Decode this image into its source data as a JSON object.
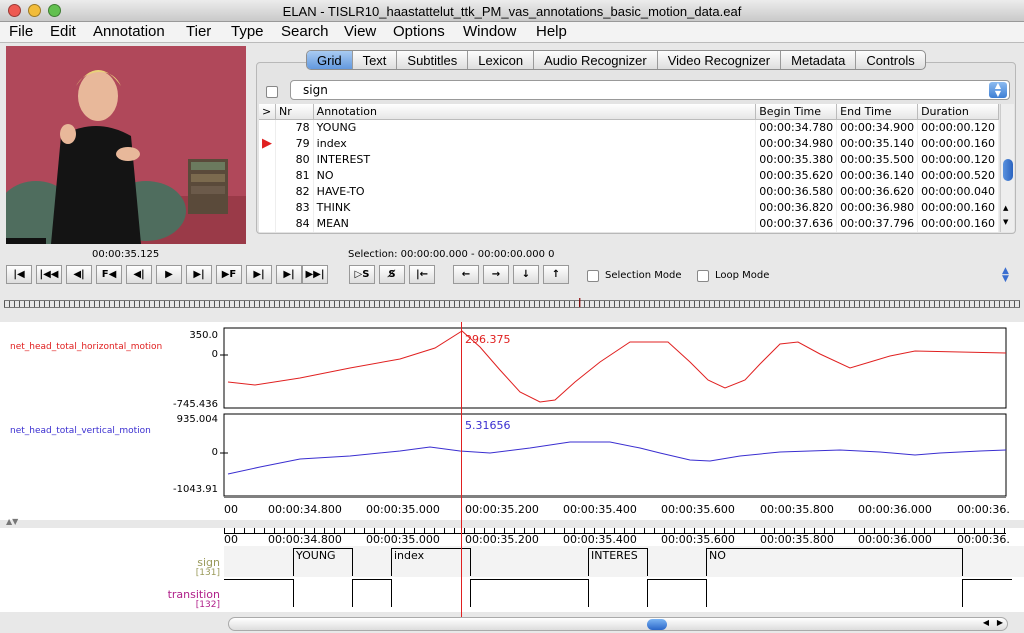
{
  "window": {
    "title": "ELAN - TISLR10_haastattelut_ttk_PM_vas_annotations_basic_motion_data.eaf"
  },
  "menu": [
    "File",
    "Edit",
    "Annotation",
    "Tier",
    "Type",
    "Search",
    "View",
    "Options",
    "Window",
    "Help"
  ],
  "tabs": [
    {
      "label": "Grid",
      "active": true
    },
    {
      "label": "Text"
    },
    {
      "label": "Subtitles"
    },
    {
      "label": "Lexicon"
    },
    {
      "label": "Audio Recognizer"
    },
    {
      "label": "Video Recognizer"
    },
    {
      "label": "Metadata"
    },
    {
      "label": "Controls"
    }
  ],
  "grid": {
    "tier": "sign",
    "columns": [
      ">",
      "Nr",
      "Annotation",
      "Begin Time",
      "End Time",
      "Duration"
    ],
    "rows": [
      {
        "nr": "78",
        "annotation": "YOUNG",
        "begin": "00:00:34.780",
        "end": "00:00:34.900",
        "duration": "00:00:00.120",
        "current": false
      },
      {
        "nr": "79",
        "annotation": "index",
        "begin": "00:00:34.980",
        "end": "00:00:35.140",
        "duration": "00:00:00.160",
        "current": true
      },
      {
        "nr": "80",
        "annotation": "INTEREST",
        "begin": "00:00:35.380",
        "end": "00:00:35.500",
        "duration": "00:00:00.120",
        "current": false
      },
      {
        "nr": "81",
        "annotation": "NO",
        "begin": "00:00:35.620",
        "end": "00:00:36.140",
        "duration": "00:00:00.520",
        "current": false
      },
      {
        "nr": "82",
        "annotation": "HAVE-TO",
        "begin": "00:00:36.580",
        "end": "00:00:36.620",
        "duration": "00:00:00.040",
        "current": false
      },
      {
        "nr": "83",
        "annotation": "THINK",
        "begin": "00:00:36.820",
        "end": "00:00:36.980",
        "duration": "00:00:00.160",
        "current": false
      },
      {
        "nr": "84",
        "annotation": "MEAN",
        "begin": "00:00:37.636",
        "end": "00:00:37.796",
        "duration": "00:00:00.160",
        "current": false
      }
    ]
  },
  "player": {
    "timecode": "00:00:35.125",
    "selection": "Selection: 00:00:00.000 - 00:00:00.000  0"
  },
  "controls": {
    "buttons": [
      "|◀",
      "|◀◀",
      "◀|",
      "F◀",
      "◀|",
      "▶",
      "▶|",
      "▶F",
      "▶|",
      "▶|",
      "▶▶|"
    ],
    "selbuttons": [
      "▷S",
      "S̸",
      "|←"
    ],
    "navbuttons": [
      "←",
      "→",
      "↓",
      "↑"
    ],
    "selection_mode": "Selection Mode",
    "loop_mode": "Loop Mode"
  },
  "signals": [
    {
      "name": "net_head_total_horizontal_motion",
      "max": "350.0",
      "zero": "0",
      "min": "-745.436",
      "cursor_value": "296.375",
      "color": "#e02020"
    },
    {
      "name": "net_head_total_vertical_motion",
      "max": "935.004",
      "zero": "0",
      "min": "-1043.91",
      "cursor_value": "5.31656",
      "color": "#3a2ed0"
    }
  ],
  "ruler": {
    "labels": [
      "00",
      "00:00:34.800",
      "00:00:35.000",
      "00:00:35.200",
      "00:00:35.400",
      "00:00:35.600",
      "00:00:35.800",
      "00:00:36.000",
      "00:00:36."
    ]
  },
  "tiers": [
    {
      "name": "sign",
      "count": "[131]",
      "color": "#9a9a5a",
      "annotations": [
        "YOUNG",
        "index",
        "INTERES",
        "NO"
      ]
    },
    {
      "name": "transition",
      "count": "[132]",
      "color": "#b0208a",
      "annotations": [
        "",
        "",
        "",
        "",
        "",
        ""
      ]
    }
  ]
}
